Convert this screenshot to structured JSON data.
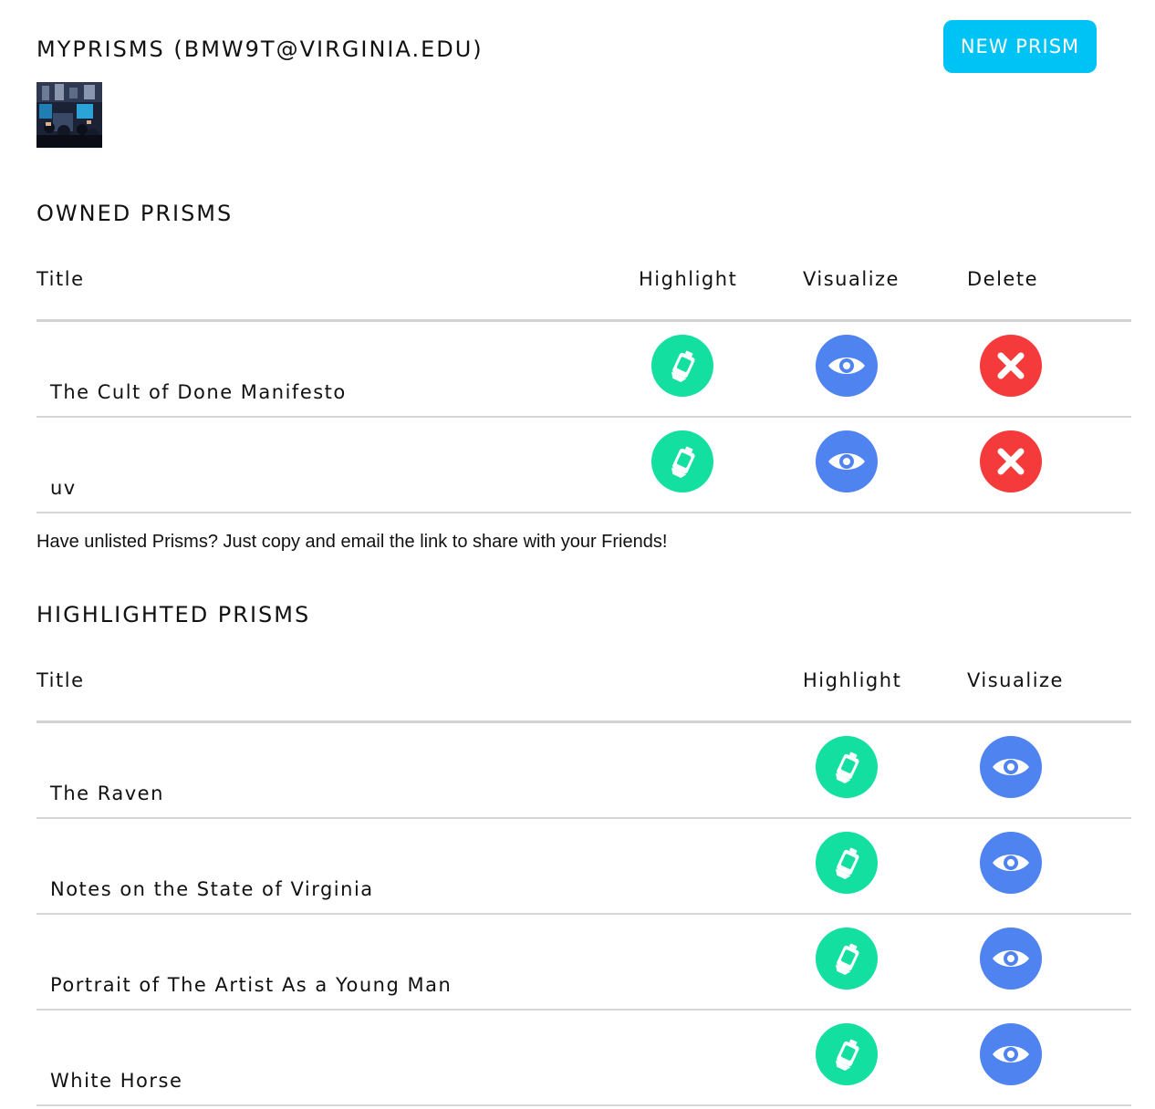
{
  "header": {
    "title": "MYPRISMS (BMW9T@VIRGINIA.EDU)",
    "new_prism_label": "NEW PRISM"
  },
  "colors": {
    "accent": "#00c3f5",
    "highlight": "#12dfa0",
    "visualize": "#4f83f0",
    "delete": "#f43a3a"
  },
  "owned": {
    "heading": "OWNED PRISMS",
    "columns": {
      "title": "Title",
      "highlight": "Highlight",
      "visualize": "Visualize",
      "delete": "Delete"
    },
    "rows": [
      {
        "title": "The Cult of Done Manifesto"
      },
      {
        "title": "uv"
      }
    ]
  },
  "note": "Have unlisted Prisms? Just copy and email the link to share with your Friends!",
  "highlighted": {
    "heading": "HIGHLIGHTED PRISMS",
    "columns": {
      "title": "Title",
      "highlight": "Highlight",
      "visualize": "Visualize"
    },
    "rows": [
      {
        "title": "The Raven"
      },
      {
        "title": "Notes on the State of Virginia"
      },
      {
        "title": "Portrait of The Artist As a Young Man"
      },
      {
        "title": "White Horse"
      }
    ]
  },
  "icons": {
    "highlight": "highlighter-icon",
    "visualize": "eye-icon",
    "delete": "close-icon"
  }
}
